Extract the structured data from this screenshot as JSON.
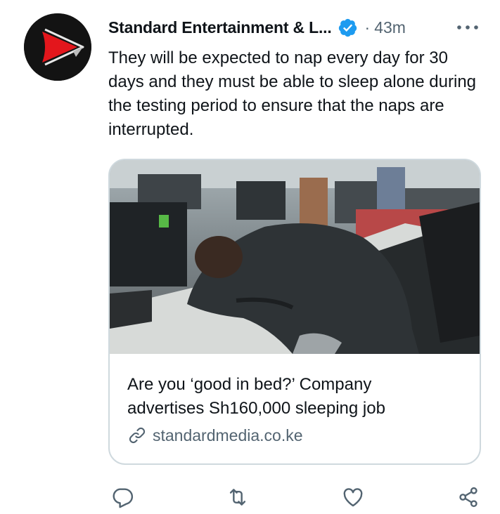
{
  "tweet": {
    "author_name": "Standard Entertainment & L...",
    "separator": "·",
    "time": "43m",
    "text": "They will be expected to nap every day for 30 days and they must be able to sleep alone during the testing period to ensure that the naps are interrupted."
  },
  "card": {
    "title": "Are you ‘good in bed?’ Company advertises Sh160,000 sleeping job",
    "domain": "standardmedia.co.ke"
  },
  "actions": [
    "reply-icon",
    "retweet-icon",
    "like-icon",
    "share-icon"
  ],
  "colors": {
    "text_primary": "#0f1419",
    "text_secondary": "#536471",
    "verified": "#1d9bf0",
    "brand_red": "#e3161c",
    "border": "#cfd9de"
  }
}
